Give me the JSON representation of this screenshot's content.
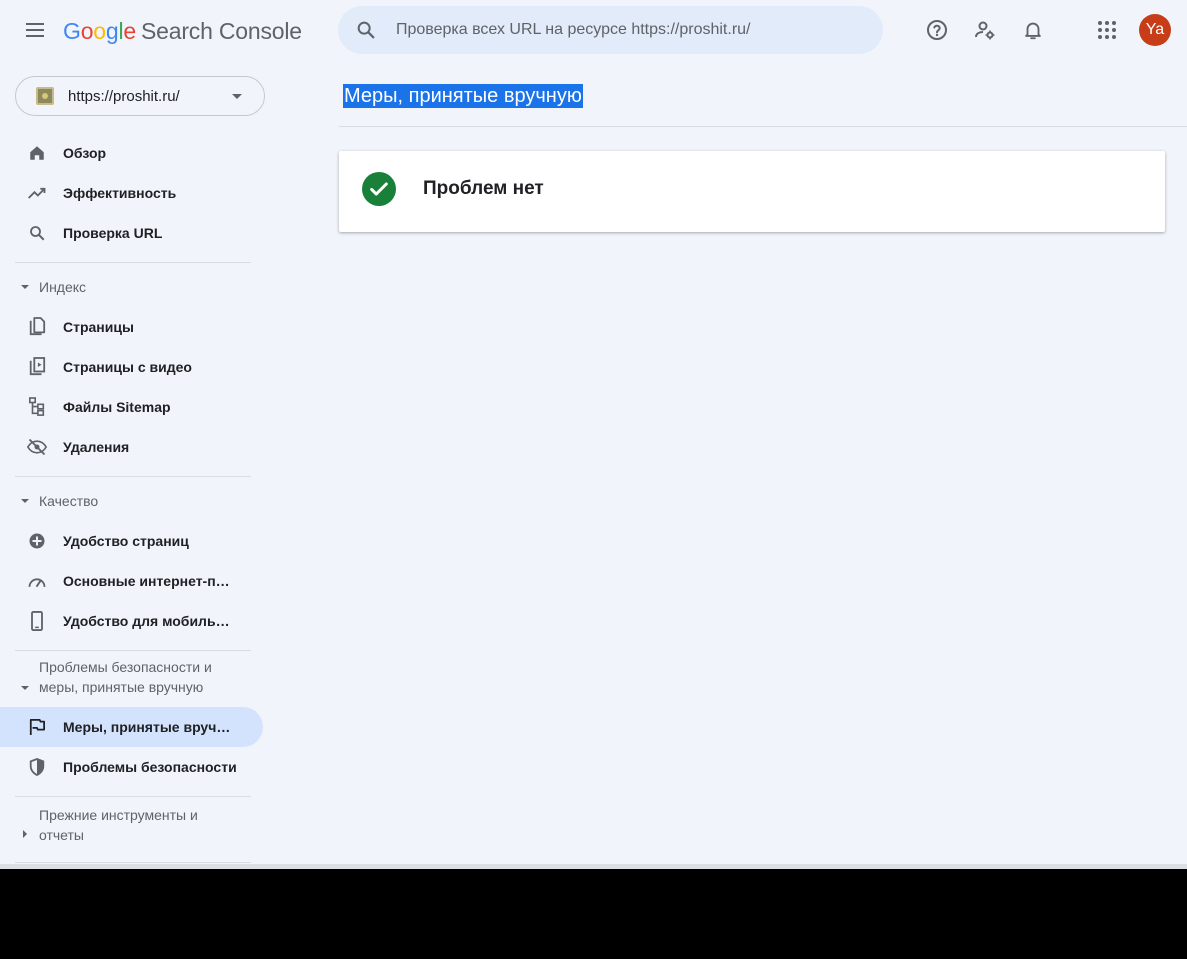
{
  "header": {
    "logo_letters": [
      "G",
      "o",
      "o",
      "g",
      "l",
      "e"
    ],
    "product": "Search Console",
    "search_placeholder": "Проверка всех URL на ресурсе https://proshit.ru/",
    "avatar_initials": "Ya",
    "icons": [
      "menu-icon",
      "search-icon",
      "help-icon",
      "manage-users-icon",
      "bell-icon",
      "apps-grid-icon"
    ]
  },
  "property": {
    "label": "https://proshit.ru/"
  },
  "sidebar": {
    "top": [
      {
        "label": "Обзор",
        "icon": "home-icon"
      },
      {
        "label": "Эффективность",
        "icon": "trending-icon"
      },
      {
        "label": "Проверка URL",
        "icon": "search-icon"
      }
    ],
    "sections": [
      {
        "title": "Индекс",
        "items": [
          {
            "label": "Страницы",
            "icon": "pages-icon"
          },
          {
            "label": "Страницы с видео",
            "icon": "video-pages-icon"
          },
          {
            "label": "Файлы Sitemap",
            "icon": "sitemap-icon"
          },
          {
            "label": "Удаления",
            "icon": "eye-off-icon"
          }
        ]
      },
      {
        "title": "Качество",
        "items": [
          {
            "label": "Удобство страниц",
            "icon": "plus-circle-icon"
          },
          {
            "label": "Основные интернет-показатели",
            "icon": "speedometer-icon"
          },
          {
            "label": "Удобство для мобильных устройств",
            "icon": "phone-icon"
          }
        ]
      },
      {
        "title": "Проблемы безопасности и меры, принятые вручную",
        "items": [
          {
            "label": "Меры, принятые вручную",
            "icon": "flag-icon",
            "active": true
          },
          {
            "label": "Проблемы безопасности",
            "icon": "shield-icon"
          }
        ]
      },
      {
        "title": "Прежние инструменты и отчеты",
        "items": []
      }
    ]
  },
  "main": {
    "title": "Меры, принятые вручную",
    "status_text": "Проблем нет"
  },
  "colors": {
    "accent": "#1a73e8",
    "active_bg": "#d3e3fd",
    "success": "#188038",
    "avatar_bg": "#c63d17",
    "page_bg": "#f1f5fb"
  }
}
